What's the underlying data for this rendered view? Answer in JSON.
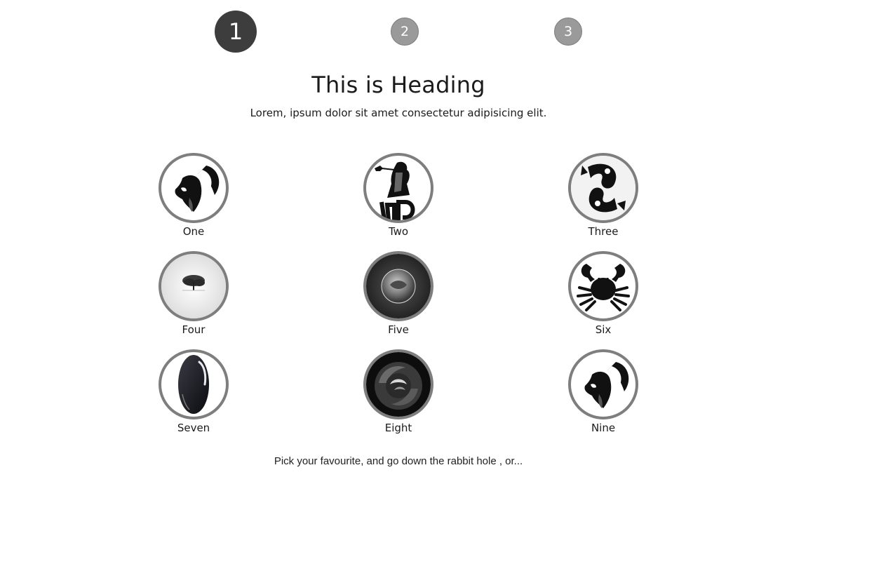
{
  "steps": [
    {
      "label": "1",
      "state": "active"
    },
    {
      "label": "2",
      "state": "inactive"
    },
    {
      "label": "3",
      "state": "inactive"
    }
  ],
  "header": {
    "title": "This is Heading",
    "subtitle": "Lorem, ipsum dolor sit amet consectetur adipisicing elit."
  },
  "options": [
    {
      "label": "One",
      "icon": "capricorn-goat-icon"
    },
    {
      "label": "Two",
      "icon": "virgo-maiden-icon"
    },
    {
      "label": "Three",
      "icon": "pisces-fish-icon"
    },
    {
      "label": "Four",
      "icon": "lone-tree-icon"
    },
    {
      "label": "Five",
      "icon": "crystal-ball-icon"
    },
    {
      "label": "Six",
      "icon": "cancer-crab-icon"
    },
    {
      "label": "Seven",
      "icon": "black-gem-icon"
    },
    {
      "label": "Eight",
      "icon": "rose-flower-icon"
    },
    {
      "label": "Nine",
      "icon": "capricorn-goat-icon"
    }
  ],
  "footer": {
    "text": "Pick your favourite, and go down the rabbit hole , or..."
  },
  "colors": {
    "active_step": "#3d3d3d",
    "inactive_step": "#9a9a9a",
    "ring": "#7e7e7e"
  }
}
